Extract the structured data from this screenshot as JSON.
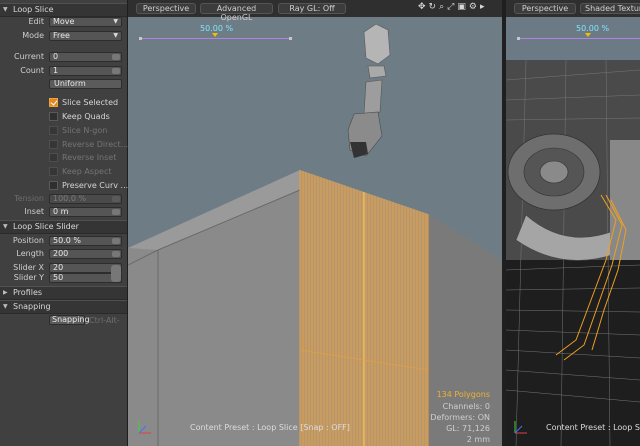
{
  "panel": {
    "loop_slice_header": "Loop Slice",
    "edit_label": "Edit",
    "edit_value": "Move",
    "mode_label": "Mode",
    "mode_value": "Free",
    "current_label": "Current",
    "current_value": "0",
    "count_label": "Count",
    "count_value": "1",
    "uniform_button": "Uniform",
    "options": [
      {
        "label": "Slice Selected",
        "checked": true,
        "enabled": true
      },
      {
        "label": "Keep Quads",
        "checked": false,
        "enabled": true
      },
      {
        "label": "Slice N-gon",
        "checked": false,
        "enabled": false
      },
      {
        "label": "Reverse Direct...",
        "checked": false,
        "enabled": false
      },
      {
        "label": "Reverse Inset",
        "checked": false,
        "enabled": false
      },
      {
        "label": "Keep Aspect",
        "checked": false,
        "enabled": false
      },
      {
        "label": "Preserve Curv ...",
        "checked": false,
        "enabled": true
      }
    ],
    "tension_label": "Tension",
    "tension_value": "100.0 %",
    "inset_label": "Inset",
    "inset_value": "0 m",
    "slider_header": "Loop Slice Slider",
    "position_label": "Position",
    "position_value": "50.0 %",
    "length_label": "Length",
    "length_value": "200",
    "sliderx_label": "Slider X",
    "sliderx_value": "20",
    "slidery_label": "Slider Y",
    "slidery_value": "50",
    "profiles_header": "Profiles",
    "snapping_header": "Snapping",
    "snapping_button": "Snapping",
    "snapping_shortcut": "Ctrl-Alt-"
  },
  "viewport_main": {
    "tabs": [
      "Perspective",
      "Advanced OpenGL",
      "Ray GL: Off"
    ],
    "icons": [
      "move-icon",
      "rotate-icon",
      "zoom-icon",
      "fit-icon",
      "maximize-icon",
      "settings-icon",
      "play-icon"
    ],
    "slider_percent": "50.00 %",
    "stats": {
      "polygons": "134 Polygons",
      "channels": "Channels: 0",
      "deformers": "Deformers: ON",
      "gl": "GL: 71,126",
      "scale": "2 mm"
    },
    "status_text": "Content Preset : Loop Slice  [Snap : OFF]"
  },
  "viewport_right": {
    "tabs": [
      "Perspective",
      "Shaded Texture"
    ],
    "slider_percent": "50.00 %",
    "status_text": "Content Preset : Loop Slice  [Snap : OFF]"
  },
  "colors": {
    "accent_orange": "#e08a1e",
    "slider_purple": "#b482e0",
    "slider_text": "#7fe6ff",
    "stats_polygons": "#f0b030"
  }
}
